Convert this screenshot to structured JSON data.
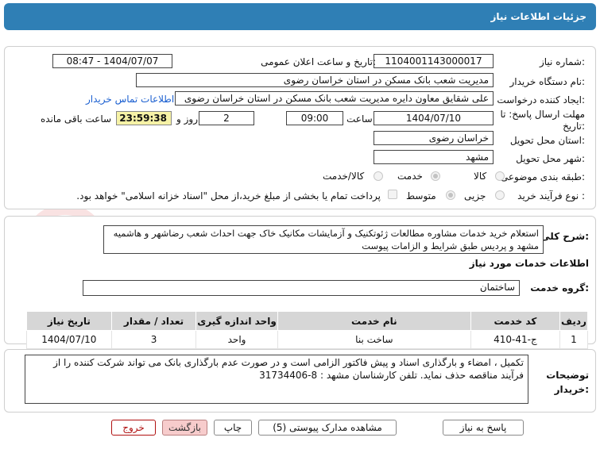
{
  "header": {
    "title": "جزئیات اطلاعات نیاز"
  },
  "form": {
    "need_number_label": "شماره نیاز:",
    "need_number": "1104001143000017",
    "announce_label": "تاریخ و ساعت اعلان عمومی:",
    "announce_value": "1404/07/07 - 08:47",
    "buyer_label": "نام دستگاه خریدار:",
    "buyer_value": "مدیریت شعب بانک مسکن در استان خراسان رضوی",
    "creator_label": "ایجاد کننده درخواست:",
    "creator_value": "علی شقایق معاون دایره مدیریت شعب بانک مسکن در استان خراسان رضوی",
    "contact_link": "اطلاعات تماس خریدار",
    "deadline_label": "مهلت ارسال پاسخ: تا تاریخ:",
    "deadline_date": "1404/07/10",
    "time_label": "ساعت",
    "deadline_time": "09:00",
    "days_value": "2",
    "days_label": "روز و",
    "remaining_time": "23:59:38",
    "remaining_label": "ساعت باقی مانده",
    "province_label": "استان محل تحویل:",
    "province_value": "خراسان رضوی",
    "city_label": "شهر محل تحویل:",
    "city_value": "مشهد",
    "category_label": "طبقه بندی موضوعی:",
    "category_options": [
      "کالا",
      "خدمت",
      "کالا/خدمت"
    ],
    "process_label": "نوع فرآیند خرید :",
    "process_options": [
      "جزیی",
      "متوسط"
    ],
    "payment_note": "پرداخت تمام یا بخشی از مبلغ خرید،از محل \"اسناد خزانه اسلامی\" خواهد بود."
  },
  "description": {
    "label": "شرح کلی نیاز:",
    "text": "استعلام خرید خدمات مشاوره مطالعات ژئوتکنیک و آزمایشات مکانیک خاک جهت احداث شعب رضاشهر و هاشمیه مشهد و پردیس طبق شرایط و الزامات پیوست"
  },
  "services": {
    "section_title": "اطلاعات خدمات مورد نیاز",
    "group_label": "گروه خدمت:",
    "group_value": "ساختمان",
    "table": {
      "headers": [
        "ردیف",
        "کد خدمت",
        "نام خدمت",
        "واحد اندازه گیری",
        "تعداد / مقدار",
        "تاریخ نیاز"
      ],
      "rows": [
        [
          "1",
          "ج-41-410",
          "ساخت بنا",
          "واحد",
          "3",
          "1404/07/10"
        ]
      ]
    }
  },
  "buyer_notes": {
    "label": "توضیحات خریدار:",
    "text": "تکمیل ، امضاء و بارگذاری اسناد و پیش فاکتور الزامی است و در صورت عدم بارگذاری بانک می تواند شرکت کننده را از فرآیند مناقصه حذف نماید. تلفن کارشناسان مشهد : 8-31734406"
  },
  "buttons": {
    "reply": "پاسخ به نیاز",
    "attachments": "مشاهده مدارک پیوستی (5)",
    "print": "چاپ",
    "back": "بازگشت",
    "exit": "خروج"
  },
  "watermark": "AriaTender.net",
  "colors": {
    "header": "#2f7fb5",
    "timer": "#f6f2a6",
    "link": "#1a5fd0",
    "exit": "#b01010"
  }
}
